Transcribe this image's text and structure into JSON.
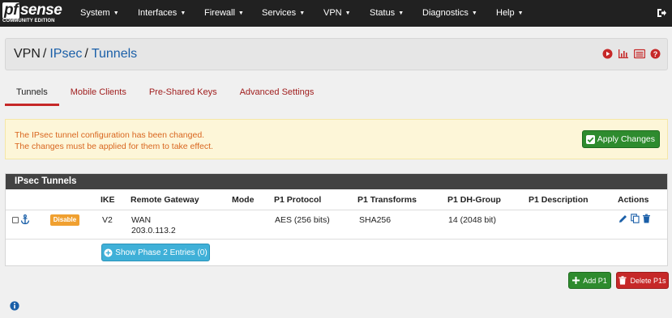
{
  "app": {
    "logo_prefix": "pf",
    "logo_main": "sense",
    "logo_edition": "COMMUNITY EDITION"
  },
  "nav": {
    "items": [
      "System",
      "Interfaces",
      "Firewall",
      "Services",
      "VPN",
      "Status",
      "Diagnostics",
      "Help"
    ]
  },
  "breadcrumb": {
    "part1": "VPN",
    "part2": "IPsec",
    "part3": "Tunnels",
    "separator": "/"
  },
  "tabs": [
    "Tunnels",
    "Mobile Clients",
    "Pre-Shared Keys",
    "Advanced Settings"
  ],
  "active_tab": "Tunnels",
  "alert": {
    "line1": "The IPsec tunnel configuration has been changed.",
    "line2": "The changes must be applied for them to take effect.",
    "apply_label": "Apply Changes"
  },
  "panel": {
    "title": "IPsec Tunnels",
    "headers": [
      "IKE",
      "Remote Gateway",
      "Mode",
      "P1 Protocol",
      "P1 Transforms",
      "P1 DH-Group",
      "P1 Description",
      "Actions"
    ],
    "row": {
      "disable_label": "Disable",
      "ike": "V2",
      "gateway_line1": "WAN",
      "gateway_line2": "203.0.113.2",
      "mode": "",
      "protocol": "AES (256 bits)",
      "transforms": "SHA256",
      "dh_group": "14 (2048 bit)",
      "description": ""
    },
    "phase2_label": "Show Phase 2 Entries (0)"
  },
  "buttons": {
    "add_label": "Add P1",
    "delete_label": "Delete P1s"
  },
  "colors": {
    "nav_bg": "#212121",
    "accent_red": "#c62828",
    "link_blue": "#1a5fa8",
    "success_green": "#2e8b2e",
    "warning_orange": "#f0a030",
    "info_cyan": "#3fb0d8"
  }
}
